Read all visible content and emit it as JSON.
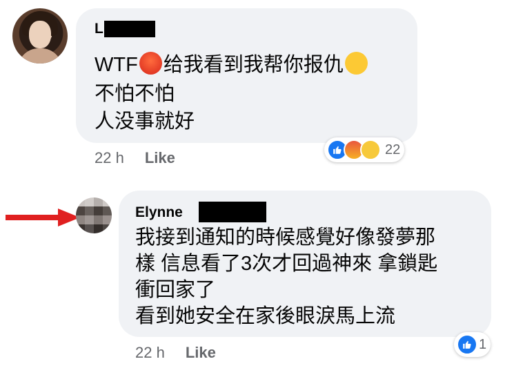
{
  "comments": [
    {
      "author": "L",
      "lines": [
        "WTF",
        "给我看到我帮你报仇",
        "不怕不怕",
        "人没事就好"
      ],
      "time": "22 h",
      "like_label": "Like",
      "reaction_count": "22",
      "reaction_icons": [
        "like-icon",
        "angry-icon",
        "haha-icon"
      ]
    },
    {
      "author": "Elynne",
      "lines": [
        "我接到通知的時候感覺好像發夢那",
        "樣 信息看了3次才回過神來 拿鎖匙",
        "衝回家了",
        "看到她安全在家後眼淚馬上流"
      ],
      "time": "22 h",
      "like_label": "Like",
      "reaction_count": "1",
      "reaction_icons": [
        "like-icon"
      ]
    }
  ],
  "colors": {
    "bubble": "#f0f2f5",
    "meta": "#65676b",
    "like_blue": "#1877f2",
    "arrow": "#e02020"
  }
}
